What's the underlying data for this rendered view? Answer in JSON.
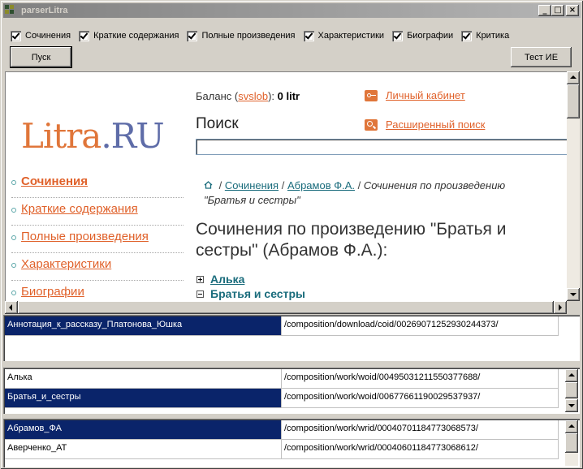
{
  "window": {
    "title": "parserLitra",
    "minimize": "_",
    "maximize": "□",
    "close": "×"
  },
  "options": [
    {
      "label": "Сочинения",
      "checked": true
    },
    {
      "label": "Краткие содержания",
      "checked": true
    },
    {
      "label": "Полные произведения",
      "checked": true
    },
    {
      "label": "Характеристики",
      "checked": true
    },
    {
      "label": "Биографии",
      "checked": true
    },
    {
      "label": "Критика",
      "checked": true
    }
  ],
  "buttons": {
    "start": "Пуск",
    "test_ie": "Тест ИЕ"
  },
  "site": {
    "logo_part1": "Litra",
    "logo_part2": ".RU",
    "balance_prefix": "Баланс (",
    "balance_user": "svslob",
    "balance_mid": "): ",
    "balance_value": "0 litr",
    "cabinet_link": "Личный кабинет",
    "search_title": "Поиск",
    "advanced_search_link": "Расширенный поиск",
    "nav": [
      {
        "label": "Сочинения",
        "active": true
      },
      {
        "label": "Краткие содержания",
        "active": false
      },
      {
        "label": "Полные произведения",
        "active": false
      },
      {
        "label": "Характеристики",
        "active": false
      },
      {
        "label": "Биографии",
        "active": false
      }
    ],
    "breadcrumb": {
      "sep": " / ",
      "c1": "Сочинения",
      "c2": "Абрамов Ф.А.",
      "current": "Сочинения по произведению \"Братья и сестры\""
    },
    "heading": "Сочинения по произведению \"Братья и сестры\" (Абрамов Ф.А.):",
    "tree": [
      {
        "label": "Алька",
        "expanded": false
      },
      {
        "label": "Братья и сестры",
        "expanded": true
      }
    ]
  },
  "list1": {
    "rows": [
      {
        "name": "Аннотация_к_рассказу_Платонова_Юшка",
        "path": "/composition/download/coid/00269071252930244373/",
        "selected": true
      }
    ]
  },
  "list2": {
    "rows": [
      {
        "name": "Алька",
        "path": "/composition/work/woid/00495031211550377688/",
        "selected": false
      },
      {
        "name": "Братья_и_сестры",
        "path": "/composition/work/woid/00677661190029537937/",
        "selected": true
      }
    ]
  },
  "list3": {
    "rows": [
      {
        "name": "Абрамов_ФА",
        "path": "/composition/work/wrid/00040701184773068573/",
        "selected": true
      },
      {
        "name": "Аверченко_АТ",
        "path": "/composition/work/wrid/00040601184773068612/",
        "selected": false
      }
    ]
  },
  "colors": {
    "selection": "#0a246a",
    "site_link": "#e0612a",
    "teal_link": "#1a6c7c"
  }
}
